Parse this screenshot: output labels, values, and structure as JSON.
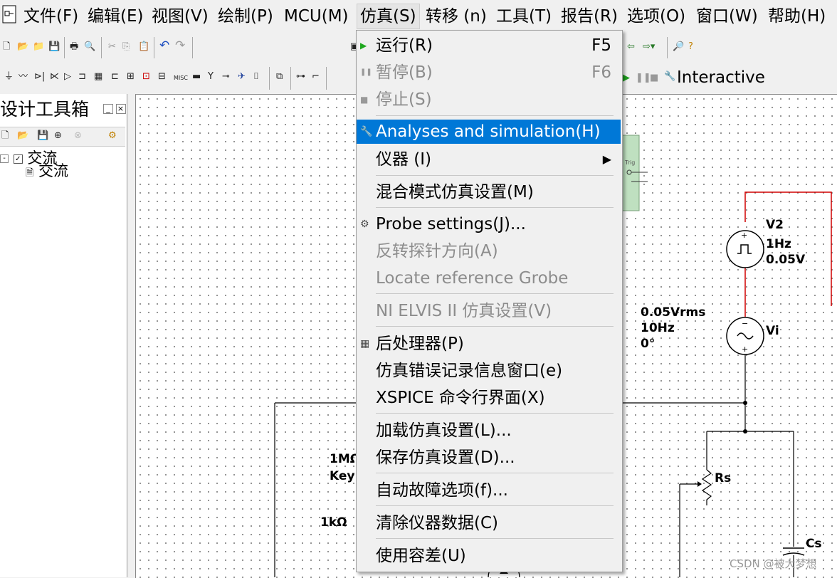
{
  "menubar": {
    "items": [
      {
        "label": "文件(F)"
      },
      {
        "label": "编辑(E)"
      },
      {
        "label": "视图(V)"
      },
      {
        "label": "绘制(P)"
      },
      {
        "label": "MCU(M)"
      },
      {
        "label": "仿真(S)"
      },
      {
        "label": "转移 (n)"
      },
      {
        "label": "工具(T)"
      },
      {
        "label": "报告(R)"
      },
      {
        "label": "选项(O)"
      },
      {
        "label": "窗口(W)"
      },
      {
        "label": "帮助(H)"
      }
    ]
  },
  "toolbar": {
    "interactive_label": "Interactive",
    "misc_label": "MISC"
  },
  "panel": {
    "title": "设计工具箱",
    "tree_root": "交流",
    "tree_child": "交流"
  },
  "dropdown": {
    "items": [
      {
        "label": "运行(R)",
        "shortcut": "F5",
        "icon": "play-icon",
        "disabled": false
      },
      {
        "label": "暂停(B)",
        "shortcut": "F6",
        "icon": "pause-icon",
        "disabled": true
      },
      {
        "label": "停止(S)",
        "shortcut": "",
        "icon": "stop-icon",
        "disabled": true
      },
      {
        "label": "Analyses and simulation(H)",
        "shortcut": "",
        "icon": "wrench-icon",
        "highlighted": true
      },
      {
        "label": "仪器  (I)",
        "shortcut": "",
        "submenu": true
      },
      {
        "label": "混合模式仿真设置(M)"
      },
      {
        "label": "Probe settings(J)...",
        "icon": "gear-icon"
      },
      {
        "label": "反转探针方向(A)",
        "disabled": true
      },
      {
        "label": "Locate reference Grobe",
        "disabled": true
      },
      {
        "label": "NI ELVIS II 仿真设置(V)",
        "disabled": true
      },
      {
        "label": "后处理器(P)",
        "icon": "calculator-icon"
      },
      {
        "label": "仿真错误记录信息窗口(e)"
      },
      {
        "label": "XSPICE 命令行界面(X)"
      },
      {
        "label": "加载仿真设置(L)..."
      },
      {
        "label": "保存仿真设置(D)..."
      },
      {
        "label": "自动故障选项(f)..."
      },
      {
        "label": "清除仪器数据(C)"
      },
      {
        "label": "使用容差(U)"
      }
    ]
  },
  "circuit": {
    "v2_name": "V2",
    "v2_freq": "1Hz",
    "v2_amp": "0.05V",
    "vi_amp": "0.05Vrms",
    "vi_freq": "10Hz",
    "vi_phase": "0°",
    "vi_name": "Vi",
    "key_res": "1MΩ",
    "key_label": "Key",
    "r1k": "1kΩ",
    "rs_name": "Rs",
    "cs_name": "Cs",
    "trig_label": "Trig",
    "colors": {
      "wire": "#000000",
      "red_wire": "#d00000",
      "highlight": "#0078d7"
    }
  },
  "watermark": "CSDN @被大梦想"
}
